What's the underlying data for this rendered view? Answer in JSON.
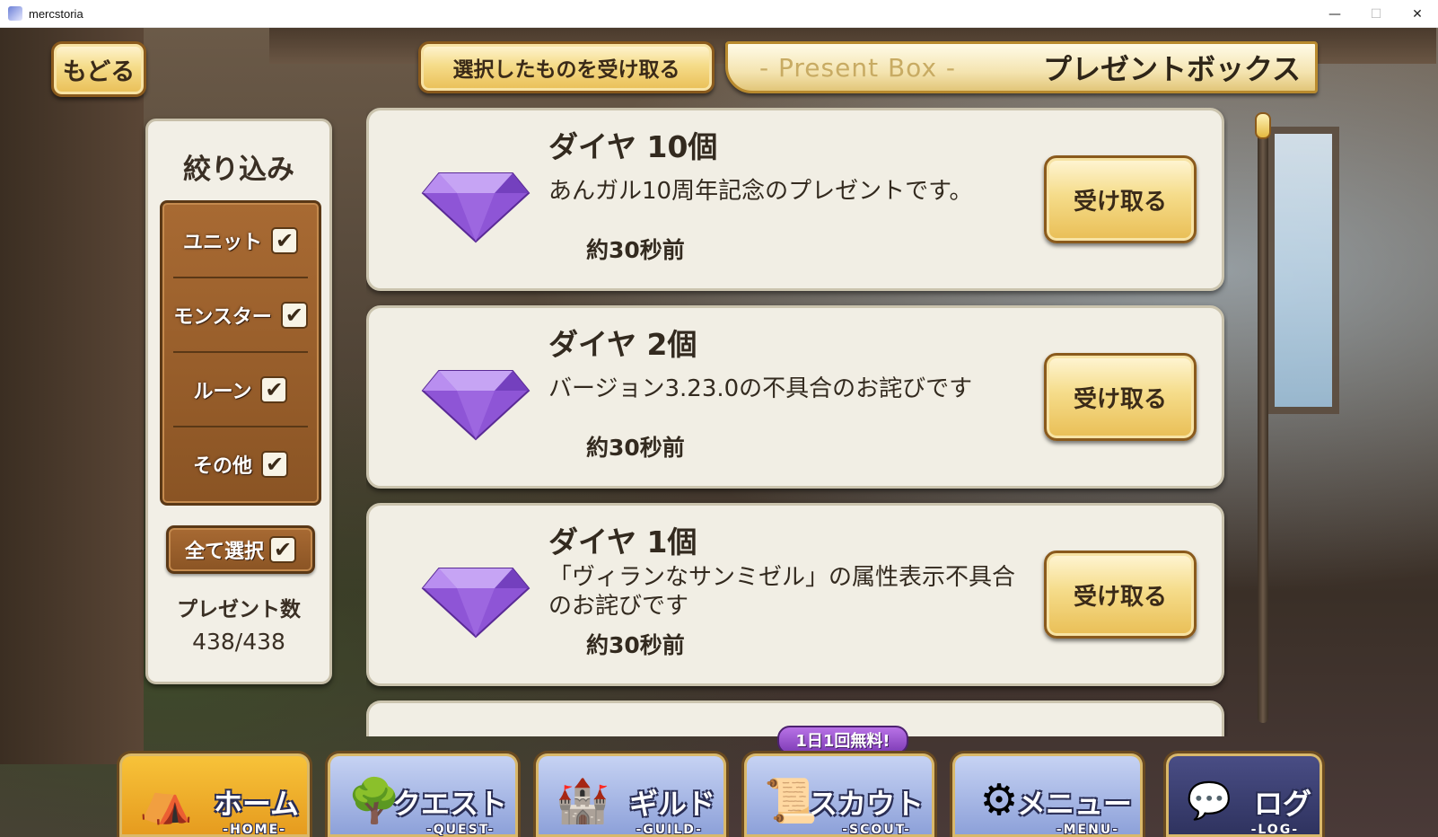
{
  "window": {
    "title": "mercstoria",
    "minimize": "—",
    "maximize": "☐",
    "close": "✕"
  },
  "header": {
    "back_label": "もどる",
    "receive_selected_label": "選択したものを受け取る",
    "title_en": "- Present Box -",
    "title_jp": "プレゼントボックス"
  },
  "filter": {
    "title": "絞り込み",
    "items": [
      {
        "label": "ユニット",
        "checked": true
      },
      {
        "label": "モンスター",
        "checked": true
      },
      {
        "label": "ルーン",
        "checked": true
      },
      {
        "label": "その他",
        "checked": true
      }
    ],
    "select_all_label": "全て選択",
    "select_all_checked": true,
    "count_label": "プレゼント数",
    "count_value": "438/438"
  },
  "presents": [
    {
      "title": "ダイヤ 10個",
      "description": "あんガル10周年記念のプレゼントです。",
      "time": "約30秒前",
      "button": "受け取る",
      "icon": "purple-diamond-icon"
    },
    {
      "title": "ダイヤ 2個",
      "description": "バージョン3.23.0の不具合のお詫びです",
      "time": "約30秒前",
      "button": "受け取る",
      "icon": "purple-diamond-icon"
    },
    {
      "title": "ダイヤ 1個",
      "description": "「ヴィランなサンミゼル」の属性表示不具合のお詫びです",
      "time": "約30秒前",
      "button": "受け取る",
      "icon": "purple-diamond-icon"
    }
  ],
  "bottom_nav": {
    "home": {
      "jp": "ホーム",
      "en": "-HOME-",
      "icon": "tent-icon"
    },
    "quest": {
      "jp": "クエスト",
      "en": "-QUEST-",
      "icon": "signpost-icon"
    },
    "guild": {
      "jp": "ギルド",
      "en": "-GUILD-",
      "icon": "castle-icon"
    },
    "scout": {
      "jp": "スカウト",
      "en": "-SCOUT-",
      "icon": "scroll-icon",
      "badge": "1日1回無料!"
    },
    "menu": {
      "jp": "メニュー",
      "en": "-MENU-",
      "icon": "gear-icon"
    },
    "log": {
      "jp": "ログ",
      "en": "-LOG-",
      "icon": "chat-bubble-icon"
    }
  },
  "colors": {
    "gold": "#e9be55",
    "panel": "#f1eee4",
    "wood": "#8a5424",
    "gem": "#8a4fd0"
  }
}
